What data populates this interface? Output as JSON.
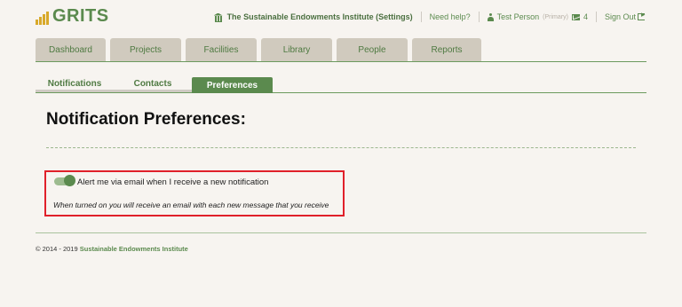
{
  "header": {
    "logo_text": "GRITS",
    "organization": "The Sustainable Endowments Institute (Settings)",
    "help": "Need help?",
    "user_name": "Test Person",
    "user_role": "(Primary)",
    "message_count": "4",
    "sign_out": "Sign Out"
  },
  "main_tabs": [
    "Dashboard",
    "Projects",
    "Facilities",
    "Library",
    "People",
    "Reports"
  ],
  "sub_tabs": [
    "Notifications",
    "Contacts",
    "Preferences"
  ],
  "active_sub_tab": "Preferences",
  "page_title": "Notification Preferences:",
  "preference": {
    "label": "Alert me via email when I receive a new notification",
    "help": "When turned on you will receive an email with each new message that you receive",
    "enabled": true
  },
  "footer": {
    "copyright": "© 2014 - 2019",
    "org_link": "Sustainable Endowments Institute"
  },
  "colors": {
    "brand_green": "#5b8a4e",
    "tab_bg": "#d0cabe",
    "highlight_border": "#e0202a",
    "logo_bars": "#d8a92a"
  }
}
